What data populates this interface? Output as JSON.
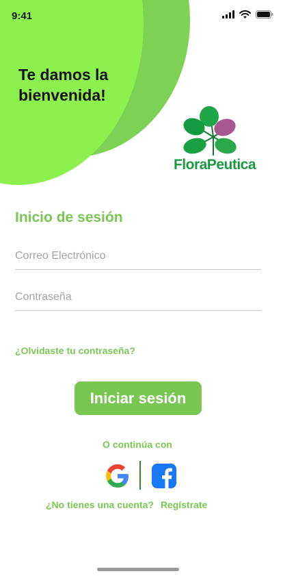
{
  "status_bar": {
    "time": "9:41"
  },
  "header": {
    "welcome": "Te damos la bienvenida!"
  },
  "logo": {
    "text": "FloraPeutica"
  },
  "form": {
    "title": "Inicio de sesión",
    "email_placeholder": "Correo Electrónico",
    "password_placeholder": "Contraseña",
    "forgot_link": "¿Olvidaste tu contraseña?",
    "login_button": "Iniciar sesión"
  },
  "social": {
    "continue_text": "O continúa con",
    "providers": [
      "google-icon",
      "facebook-icon"
    ]
  },
  "signup": {
    "prompt": "¿No tienes una cuenta?",
    "link": "Regístrate"
  },
  "colors": {
    "accent": "#7ac653",
    "blob_front": "#8cf04e",
    "blob_back": "#7dd154",
    "logo_green": "#1a9a3f"
  }
}
